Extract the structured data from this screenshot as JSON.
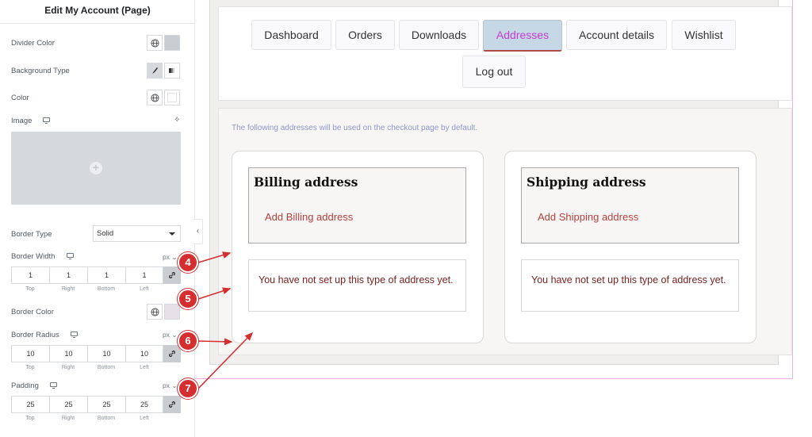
{
  "panel": {
    "title": "Edit My Account (Page)",
    "divider_color_label": "Divider Color",
    "background_type_label": "Background Type",
    "color_label": "Color",
    "image_label": "Image",
    "border_type_label": "Border Type",
    "border_type_value": "Solid",
    "border_width_label": "Border Width",
    "border_color_label": "Border Color",
    "border_radius_label": "Border Radius",
    "padding_label": "Padding",
    "unit": "px",
    "sides": [
      "Top",
      "Right",
      "Bottom",
      "Left"
    ],
    "border_width_values": [
      "1",
      "1",
      "1",
      "1"
    ],
    "border_radius_values": [
      "10",
      "10",
      "10",
      "10"
    ],
    "padding_values": [
      "25",
      "25",
      "25",
      "25"
    ],
    "divider_color_swatch": "#c9ccd0",
    "color_swatch": "#ffffff",
    "border_color_swatch": "#e6e1e8"
  },
  "nav": {
    "tabs": [
      "Dashboard",
      "Orders",
      "Downloads",
      "Addresses",
      "Account details",
      "Wishlist",
      "Log out"
    ],
    "active_tab": "Addresses"
  },
  "content": {
    "notice": "The following addresses will be used on the checkout page by default.",
    "billing": {
      "title": "Billing address",
      "link": "Add Billing address",
      "message": "You have not set up this type of address yet."
    },
    "shipping": {
      "title": "Shipping address",
      "link": "Add Shipping address",
      "message": "You have not set up this type of address yet."
    }
  },
  "callouts": [
    "4",
    "5",
    "6",
    "7"
  ],
  "colors": {
    "callout": "#d42e2e",
    "active_tab_text": "#c13fcf",
    "link": "#b3413f",
    "message": "#7a1e1e",
    "notice": "#8f95c7"
  }
}
